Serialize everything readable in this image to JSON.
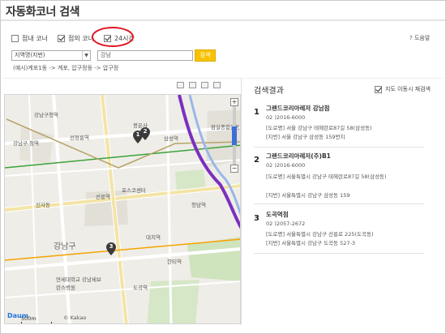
{
  "header": {
    "title": "자동화코너 검색"
  },
  "filters": [
    {
      "label": "점내 코너",
      "checked": false
    },
    {
      "label": "점외 코너",
      "checked": true
    },
    {
      "label": "24시간",
      "checked": true
    }
  ],
  "help": {
    "label": "? 도움말"
  },
  "search": {
    "select_value": "지역명(지번)",
    "input_value": "강남",
    "button_label": "검색",
    "example": "(예시)계포1동 -> 계포, 압구정동 -> 압구정"
  },
  "results": {
    "title": "검색결과",
    "auto_search_label": "지도 이동시 재검색",
    "auto_search_checked": true,
    "items": [
      {
        "number": "1",
        "name": "그랜드코리아레저 강남점",
        "phone": "02 )2016-6000",
        "road": "[도로명] 서울 강남구 테헤란로87길 58(삼성동)",
        "lot": "[지번] 서울 강남구 삼성동 159번지"
      },
      {
        "number": "2",
        "name": "그랜드코리아레저(주)B1",
        "phone": "02 )2016-6000",
        "road": "[도로명] 서울특별시 강남구 테헤란로87길 58(삼성동)",
        "lot": "[지번] 서울특별시 강남구 삼성동 159"
      },
      {
        "number": "3",
        "name": "도곡역점",
        "phone": "02 )2057-2672",
        "road": "[도로명] 서울특별시 강남구 선릉로 225(도곡동)",
        "lot": "[지번] 서울특별시 강남구 도곡동 527-3"
      }
    ]
  },
  "map": {
    "labels": {
      "gangnam_gucheong": "강남구청역",
      "cheongdam": "청담역",
      "samseong_station": "삼성역",
      "seolleung": "선릉역",
      "gangnam_gu": "강남구",
      "sports_complex": "잠실종합운동장",
      "hangnam_a": "강남구 청역",
      "bongeunsa": "봉은사",
      "posco": "포스코센터",
      "daechi": "대치역",
      "dogok": "도곡역",
      "yonsei": "연세대학교 강남세브란스병원",
      "seonjeongneung": "선정릉역",
      "sinsa": "신사동",
      "hanti": "한티역"
    },
    "markers": [
      "1",
      "2",
      "3"
    ],
    "zoom_plus": "+",
    "zoom_minus": "−",
    "zoom_level": 0.35,
    "scale": "500m",
    "copyright": "© Kakao",
    "logo": "Daum"
  },
  "colors": {
    "accent_button": "#f7c200",
    "highlight_circle": "#e0141e",
    "subway_line2": "#3aa33a",
    "subway_line9": "#b7a36b",
    "subway_bundang": "#f5a300",
    "river_line": "#7b2fbf"
  }
}
